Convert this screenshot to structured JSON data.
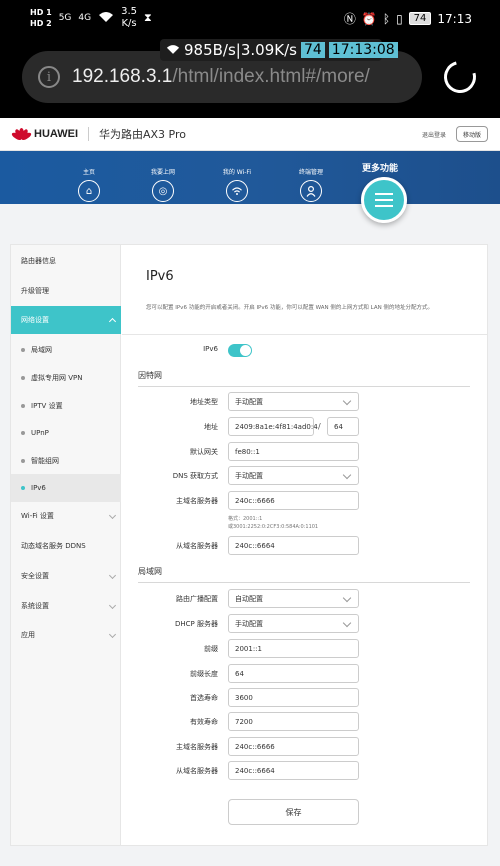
{
  "status_bar": {
    "hd1": "HD 1",
    "hd2": "HD 2",
    "sig1": "5G",
    "sig2": "4G",
    "speed_value": "3.5",
    "speed_unit": "K/s",
    "battery": "74",
    "time": "17:13"
  },
  "net_overlay": {
    "text": "985B/s|3.09K/s",
    "badge": "74",
    "time": "17:13:08"
  },
  "browser": {
    "url_host": "192.168.3.1",
    "url_path": "/html/index.html#/more/"
  },
  "header": {
    "brand": "HUAWEI",
    "model": "华为路由AX3 Pro",
    "logout": "退出登录",
    "mobile_version": "移动版"
  },
  "nav": {
    "items": [
      {
        "label": "主页",
        "icon": "home-icon"
      },
      {
        "label": "我要上网",
        "icon": "globe-icon"
      },
      {
        "label": "我的 Wi-Fi",
        "icon": "wifi-icon"
      },
      {
        "label": "终端管理",
        "icon": "user-icon"
      }
    ],
    "more_label": "更多功能",
    "more_icon": "menu-icon"
  },
  "sidebar": {
    "items": [
      {
        "label": "路由器信息"
      },
      {
        "label": "升级管理"
      },
      {
        "label": "网络设置"
      },
      {
        "label": "局域网"
      },
      {
        "label": "虚拟专用网 VPN"
      },
      {
        "label": "IPTV 设置"
      },
      {
        "label": "UPnP"
      },
      {
        "label": "智能组网"
      },
      {
        "label": "IPv6"
      },
      {
        "label": "Wi-Fi 设置"
      },
      {
        "label": "动态域名服务 DDNS"
      },
      {
        "label": "安全设置"
      },
      {
        "label": "系统设置"
      },
      {
        "label": "应用"
      }
    ]
  },
  "page": {
    "title": "IPv6",
    "description": "您可以配置 IPv6 功能的开启或者关闭。开启 IPv6 功能，你可以配置 WAN 侧的上网方式和 LAN 侧的地址分配方式。",
    "ipv6_label": "IPv6",
    "ipv6_enabled": true,
    "wan": {
      "section": "因特网",
      "addr_type_label": "地址类型",
      "addr_type_value": "手动配置",
      "address_label": "地址",
      "address_value": "2409:8a1e:4f81:4ad0:4",
      "slash": "/",
      "prefix_len_value": "64",
      "gateway_label": "默认网关",
      "gateway_value": "fe80::1",
      "dns_mode_label": "DNS 获取方式",
      "dns_mode_value": "手动配置",
      "dns1_label": "主域名服务器",
      "dns1_value": "240c::6666",
      "dns_hint1": "格式：2001::1",
      "dns_hint2": "或3001:2252:0:2CF3:0:584A:0:1101",
      "dns2_label": "从域名服务器",
      "dns2_value": "240c::6664"
    },
    "lan": {
      "section": "局域网",
      "ra_label": "路由广播配置",
      "ra_value": "自动配置",
      "dhcp_label": "DHCP 服务器",
      "dhcp_value": "手动配置",
      "prefix_label": "前缀",
      "prefix_value": "2001::1",
      "prefix_len_label": "前缀长度",
      "prefix_len_value": "64",
      "preferred_label": "首选寿命",
      "preferred_value": "3600",
      "valid_label": "有效寿命",
      "valid_value": "7200",
      "dns1_label": "主域名服务器",
      "dns1_value": "240c::6666",
      "dns2_label": "从域名服务器",
      "dns2_value": "240c::6664"
    },
    "save_label": "保存"
  },
  "colors": {
    "accent": "#3ec4c9",
    "nav_bg": "#1b5aa0",
    "brand_red": "#cf0a2c"
  }
}
